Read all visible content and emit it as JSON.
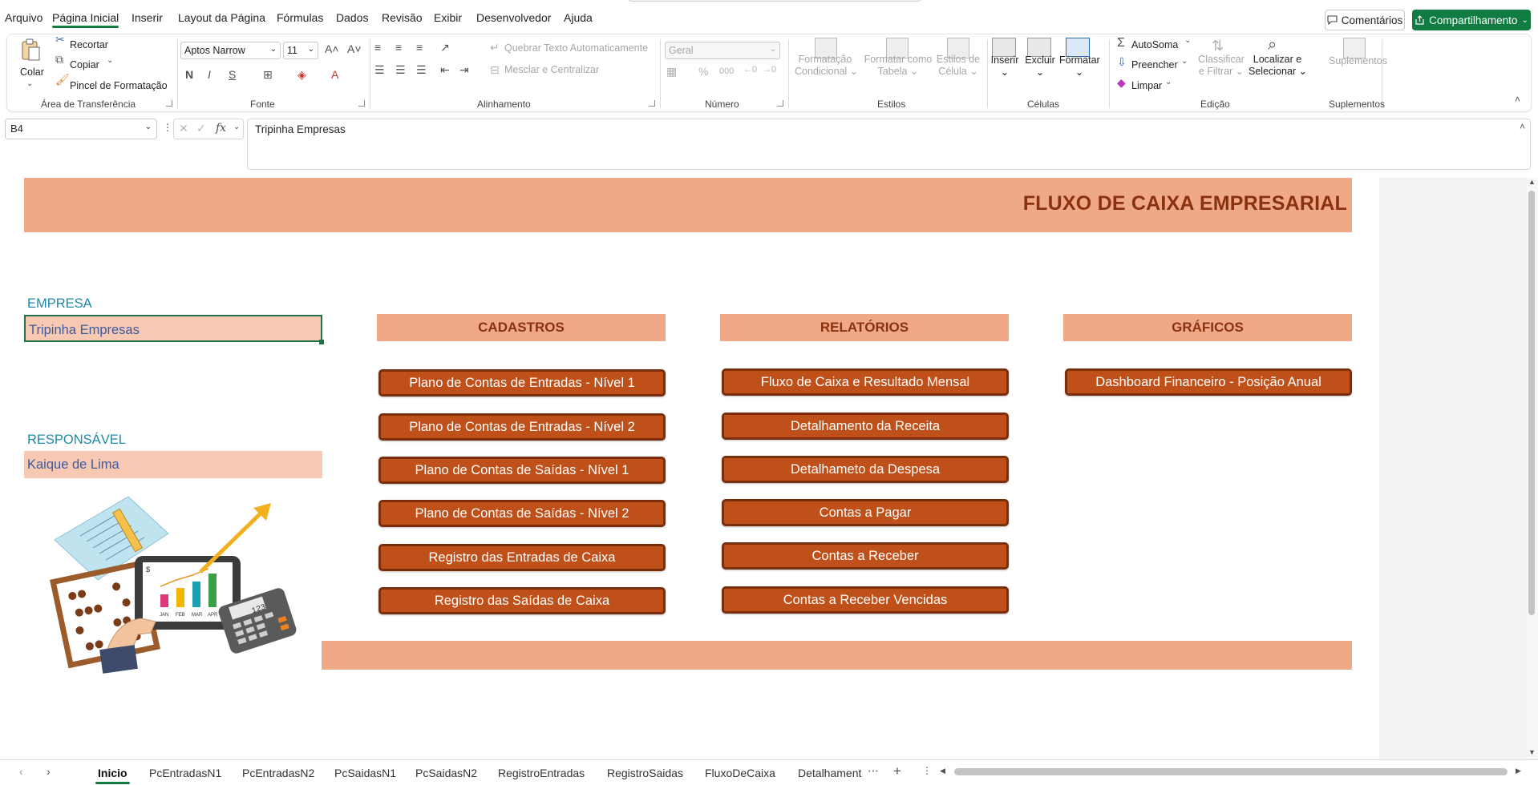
{
  "menu": {
    "items": [
      "Arquivo",
      "Página Inicial",
      "Inserir",
      "Layout da Página",
      "Fórmulas",
      "Dados",
      "Revisão",
      "Exibir",
      "Desenvolvedor",
      "Ajuda"
    ],
    "active": "Página Inicial",
    "comments_label": "Comentários",
    "share_label": "Compartilhamento"
  },
  "ribbon": {
    "clipboard": {
      "paste": "Colar",
      "cut": "Recortar",
      "copy": "Copiar",
      "format_painter": "Pincel de Formatação",
      "group": "Área de Transferência"
    },
    "font": {
      "name": "Aptos Narrow",
      "size": "11",
      "bold": "N",
      "italic": "I",
      "underline": "S",
      "group": "Fonte"
    },
    "alignment": {
      "wrap": "Quebrar Texto Automaticamente",
      "merge": "Mesclar e Centralizar",
      "group": "Alinhamento"
    },
    "number": {
      "format": "Geral",
      "group": "Número"
    },
    "styles": {
      "conditional_1": "Formatação",
      "conditional_2": "Condicional",
      "table_1": "Formatar como",
      "table_2": "Tabela",
      "cell_1": "Estilos de",
      "cell_2": "Célula",
      "group": "Estilos"
    },
    "cells": {
      "insert": "Inserir",
      "delete": "Excluir",
      "format": "Formatar",
      "group": "Células"
    },
    "editing": {
      "autosum": "AutoSoma",
      "fill": "Preencher",
      "clear": "Limpar",
      "sort_1": "Classificar",
      "sort_2": "e Filtrar",
      "find_1": "Localizar e",
      "find_2": "Selecionar",
      "group": "Edição"
    },
    "addins": {
      "label": "Suplementos",
      "group": "Suplementos"
    }
  },
  "formula_bar": {
    "cell_ref": "B4",
    "fx": "fx",
    "content": "Tripinha Empresas"
  },
  "sheet": {
    "title": "FLUXO DE CAIXA EMPRESARIAL",
    "company_label": "EMPRESA",
    "company_value": "Tripinha Empresas",
    "responsible_label": "RESPONSÁVEL",
    "responsible_value": "Kaique de Lima",
    "sections": [
      {
        "title": "CADASTROS",
        "buttons": [
          "Plano de Contas de Entradas - Nível 1",
          "Plano de Contas de Entradas - Nível 2",
          "Plano de Contas de Saídas - Nível 1",
          "Plano de Contas de Saídas - Nível 2",
          "Registro das Entradas de Caixa",
          "Registro das Saídas de Caixa"
        ]
      },
      {
        "title": "RELATÓRIOS",
        "buttons": [
          "Fluxo de Caixa e Resultado Mensal",
          "Detalhamento da Receita",
          "Detalhameto da Despesa",
          "Contas a Pagar",
          "Contas a Receber",
          "Contas a Receber Vencidas"
        ]
      },
      {
        "title": "GRÁFICOS",
        "buttons": [
          "Dashboard Financeiro - Posição Anual"
        ]
      }
    ],
    "illustration": {
      "chart_months": [
        "JAN",
        "FEB",
        "MAR",
        "APR"
      ],
      "currency": "$",
      "calculator_display": "123"
    }
  },
  "tabs": {
    "items": [
      "Inicio",
      "PcEntradasN1",
      "PcEntradasN2",
      "PcSaidasN1",
      "PcSaidasN2",
      "RegistroEntradas",
      "RegistroSaidas",
      "FluxoDeCaixa",
      "Detalhament"
    ],
    "active": "Inicio"
  },
  "colors": {
    "accent": "#107c41",
    "banner": "#f0a986",
    "button": "#c0501a",
    "field": "#f7c9b2",
    "label": "#1f8aa8"
  }
}
